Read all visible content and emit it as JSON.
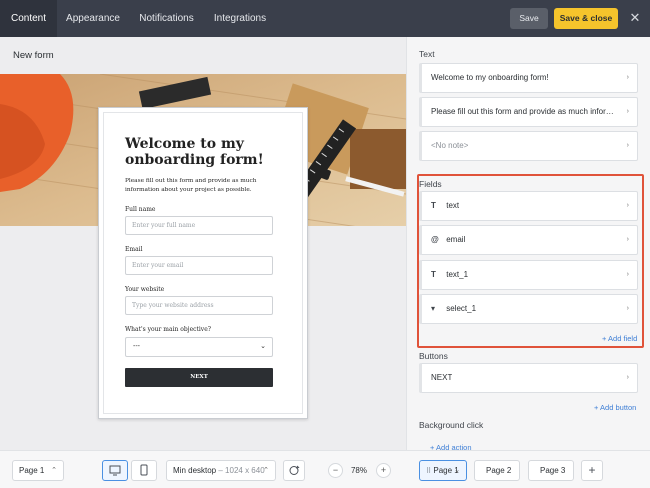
{
  "topbar": {
    "tabs": [
      {
        "label": "Content",
        "active": true
      },
      {
        "label": "Appearance"
      },
      {
        "label": "Notifications"
      },
      {
        "label": "Integrations"
      }
    ],
    "save_label": "Save",
    "save_close_label": "Save & close"
  },
  "canvas": {
    "page_name": "New form",
    "form": {
      "title": "Welcome to my onboarding form!",
      "description": "Please fill out this form and provide as much information about your project as possible.",
      "fields": [
        {
          "label": "Full name",
          "placeholder": "Enter your full name"
        },
        {
          "label": "Email",
          "placeholder": "Enter your email"
        },
        {
          "label": "Your website",
          "placeholder": "Type your website address"
        }
      ],
      "select_label": "What's your main objective?",
      "select_value": "---",
      "next_label": "NEXT"
    }
  },
  "panel": {
    "text_title": "Text",
    "text_rows": [
      {
        "text": "Welcome to my onboarding form!"
      },
      {
        "text": "Please fill out this form and provide as much informa..."
      },
      {
        "text": "<No note>"
      }
    ],
    "fields_title": "Fields",
    "fields": [
      {
        "icon": "T",
        "icon_name": "text-type-icon",
        "name": "text"
      },
      {
        "icon": "@",
        "icon_name": "email-type-icon",
        "name": "email"
      },
      {
        "icon": "T",
        "icon_name": "text-type-icon",
        "name": "text_1"
      },
      {
        "icon": "▾",
        "icon_name": "select-type-icon",
        "name": "select_1"
      }
    ],
    "add_field": "+ Add field",
    "buttons_title": "Buttons",
    "button_row": "NEXT",
    "add_button": "+ Add button",
    "background_title": "Background click",
    "add_action": "+ Add action"
  },
  "bottombar": {
    "page_select": "Page 1",
    "device_label": "Min desktop",
    "device_size": "– 1024 x 640",
    "zoom": "78%",
    "pages": [
      "Page 1",
      "Page 2",
      "Page 3"
    ]
  },
  "colors": {
    "topbar_bg": "#3a3f4b",
    "accent_yellow": "#f5c42c",
    "highlight_red": "#e0533a",
    "link_blue": "#3f7fd6"
  }
}
